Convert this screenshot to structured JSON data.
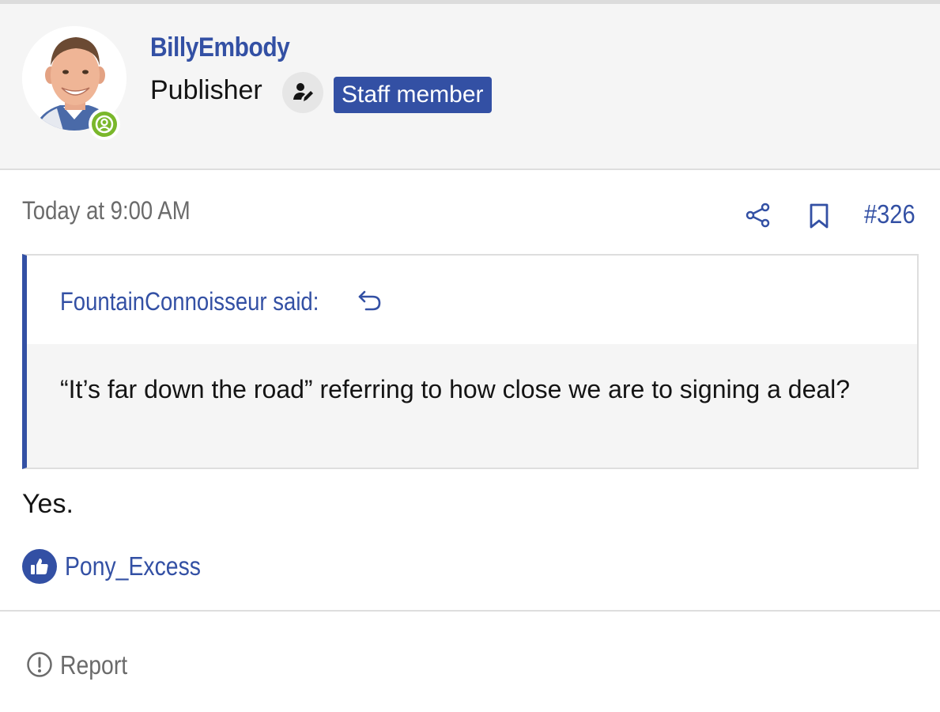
{
  "member": {
    "username": "BillyEmbody",
    "user_title": "Publisher",
    "banner": "Staff member",
    "avatar_icon": "user-avatar-photo",
    "online_icon": "online-status-icon",
    "role_icon": "publisher-pen-icon"
  },
  "post": {
    "date": "Today at 9:00 AM",
    "number": "#326",
    "share_icon": "share-icon",
    "bookmark_icon": "bookmark-icon",
    "quote": {
      "author": "FountainConnoisseur said:",
      "text": "“It’s far down the road” referring to how close we are to signing a deal?"
    },
    "message": "Yes.",
    "reaction": {
      "icon": "thumbs-up-icon",
      "users": "Pony_Excess"
    },
    "report_label": "Report"
  },
  "colors": {
    "accent": "#3350a4",
    "online": "#7ab72b",
    "muted_text": "#6b6b6b",
    "panel_bg": "#f5f5f5"
  }
}
